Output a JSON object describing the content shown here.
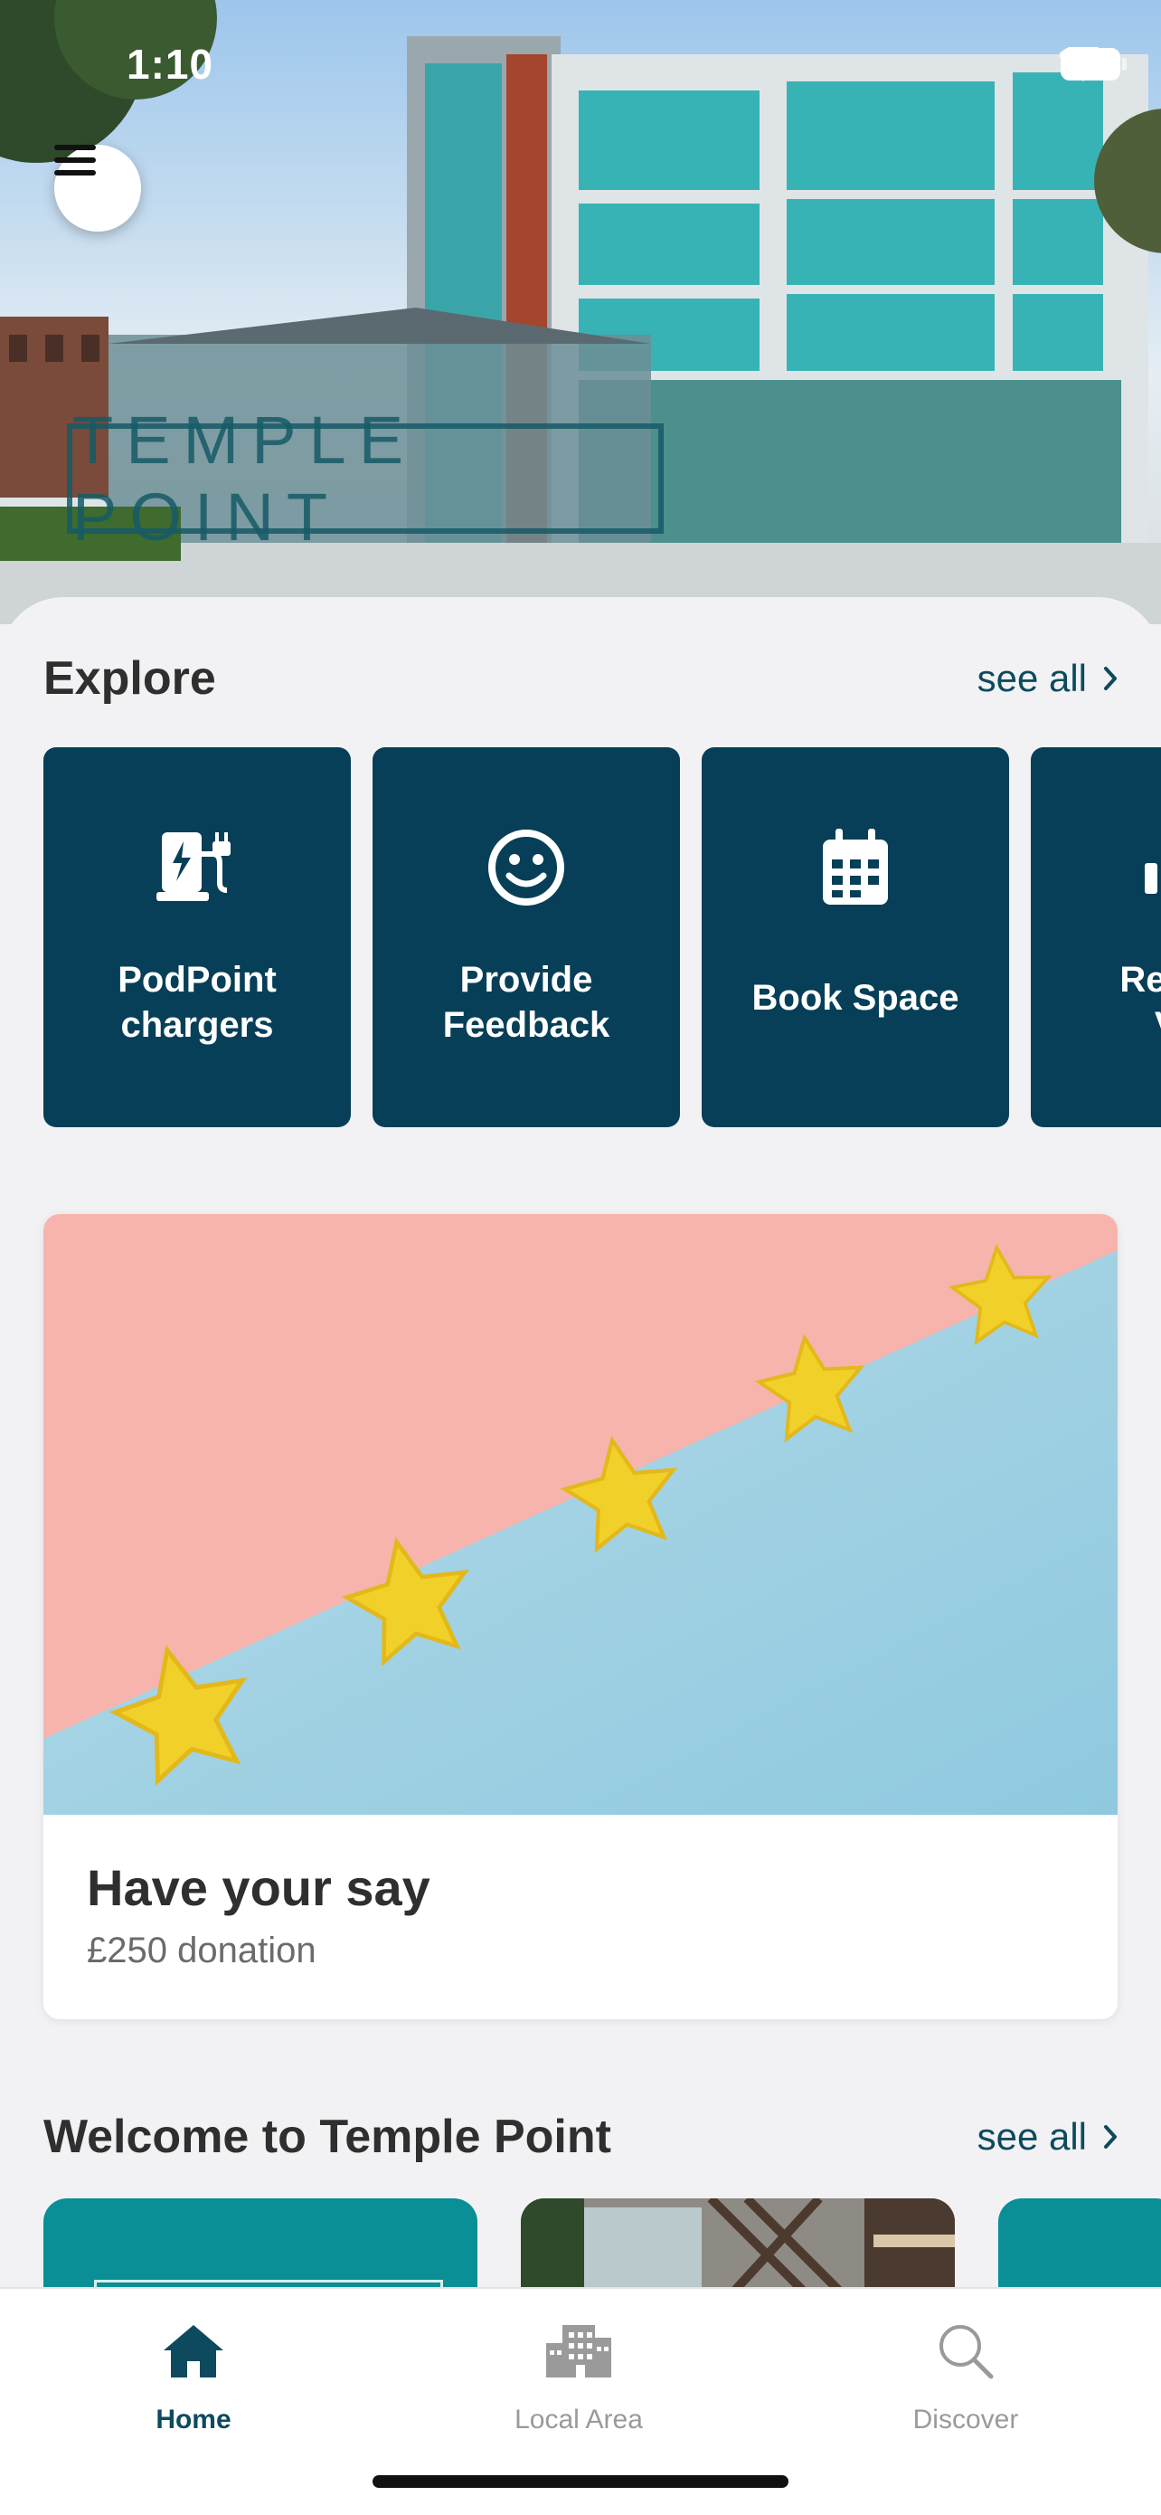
{
  "status_bar": {
    "time": "1:10"
  },
  "hero": {
    "sign_text": "TEMPLE POINT"
  },
  "explore": {
    "title": "Explore",
    "see_all": "see all",
    "tiles": [
      {
        "label": "PodPoint chargers",
        "icon": "ev-charger-icon"
      },
      {
        "label": "Provide Feedback",
        "icon": "smiley-icon"
      },
      {
        "label": "Book Space",
        "icon": "calendar-icon"
      },
      {
        "label": "Reg Vi",
        "icon": "visitor-icon"
      }
    ]
  },
  "feature_card": {
    "title": "Have your say",
    "subtitle": "£250 donation",
    "image": "five-yellow-stars-on-pink-and-blue"
  },
  "welcome": {
    "title": "Welcome to Temple Point",
    "see_all": "see all"
  },
  "tabbar": {
    "items": [
      {
        "label": "Home",
        "icon": "home-icon",
        "active": true
      },
      {
        "label": "Local Area",
        "icon": "buildings-icon",
        "active": false
      },
      {
        "label": "Discover",
        "icon": "search-icon",
        "active": false
      }
    ]
  },
  "colors": {
    "brand_dark_teal": "#063f57",
    "accent_teal": "#0a8f96",
    "tab_active": "#0d4a5e",
    "tab_inactive": "#9a9a9a"
  }
}
